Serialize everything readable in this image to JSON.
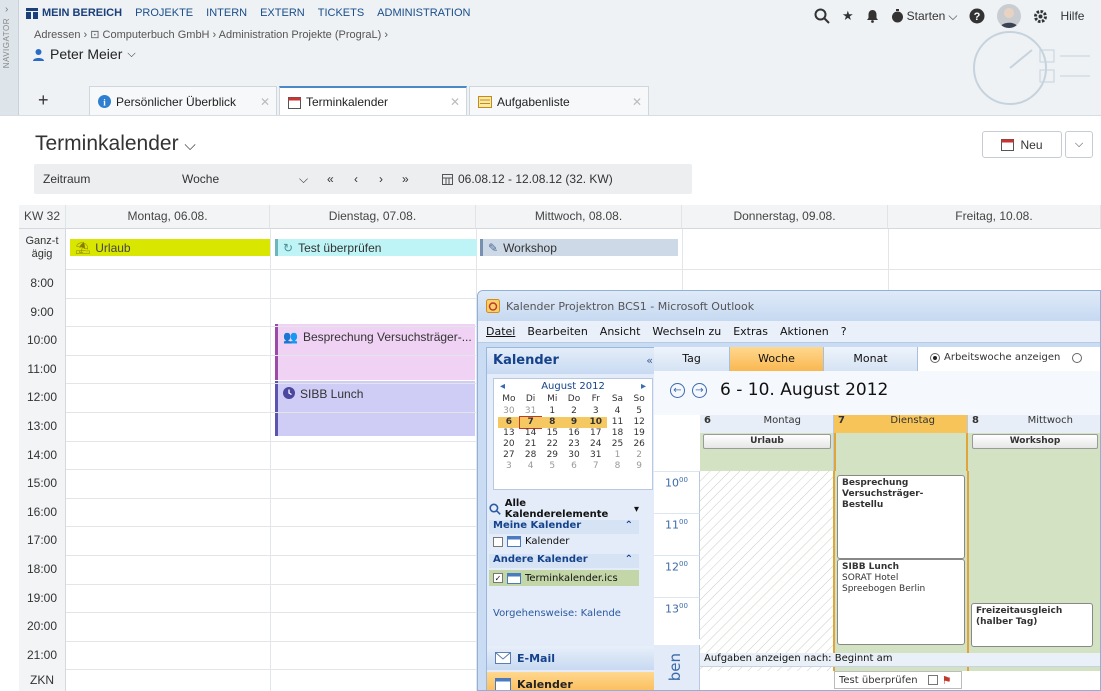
{
  "header": {
    "navigator_label": "NAVIGATOR",
    "nav_items": [
      "MEIN BEREICH",
      "PROJEKTE",
      "INTERN",
      "EXTERN",
      "TICKETS",
      "ADMINISTRATION"
    ],
    "breadcrumb": "Adressen › ⊡ Computerbuch GmbH › Administration Projekte (PrograL) ›",
    "user": "Peter Meier",
    "start_label": "Starten",
    "help_label": "Hilfe"
  },
  "tabs": [
    {
      "label": "Persönlicher Überblick"
    },
    {
      "label": "Terminkalender"
    },
    {
      "label": "Aufgabenliste"
    }
  ],
  "page": {
    "title": "Terminkalender",
    "new_button": "Neu",
    "filter": {
      "period_label": "Zeitraum",
      "period_value": "Woche",
      "prev_fast": "«",
      "prev": "‹",
      "next": "›",
      "next_fast": "»",
      "range": "06.08.12 - 12.08.12 (32. KW)"
    }
  },
  "calendar": {
    "week_label": "KW 32",
    "days": [
      "Montag, 06.08.",
      "Dienstag, 07.08.",
      "Mittwoch, 08.08.",
      "Donnerstag, 09.08.",
      "Freitag, 10.08."
    ],
    "allday_label": "Ganz-tägig",
    "hours": [
      "8:00",
      "9:00",
      "10:00",
      "11:00",
      "12:00",
      "13:00",
      "14:00",
      "15:00",
      "16:00",
      "17:00",
      "18:00",
      "19:00",
      "20:00",
      "21:00"
    ],
    "zkn_label": "ZKN",
    "allday_events": [
      {
        "label": "Urlaub",
        "color": "#d8e600"
      },
      {
        "label": "Test überprüfen",
        "color": "#bff4f6"
      },
      {
        "label": "Workshop",
        "color": "#cdd9e6"
      }
    ],
    "events": [
      {
        "label": "Besprechung Versuchsträger-...",
        "color": "#f0d2f5"
      },
      {
        "label": "SIBB Lunch",
        "color": "#cfcdf5"
      }
    ]
  },
  "outlook": {
    "title": "Kalender Projektron BCS1 - Microsoft Outlook",
    "menu": [
      "Datei",
      "Bearbeiten",
      "Ansicht",
      "Wechseln zu",
      "Extras",
      "Aktionen",
      "?"
    ],
    "nav_title": "Kalender",
    "mini_month": "August 2012",
    "mini_days": [
      "Mo",
      "Di",
      "Mi",
      "Do",
      "Fr",
      "Sa",
      "So"
    ],
    "mini_weeks": [
      [
        "30",
        "31",
        "1",
        "2",
        "3",
        "4",
        "5"
      ],
      [
        "6",
        "7",
        "8",
        "9",
        "10",
        "11",
        "12"
      ],
      [
        "13",
        "14",
        "15",
        "16",
        "17",
        "18",
        "19"
      ],
      [
        "20",
        "21",
        "22",
        "23",
        "24",
        "25",
        "26"
      ],
      [
        "27",
        "28",
        "29",
        "30",
        "31",
        "1",
        "2"
      ],
      [
        "3",
        "4",
        "5",
        "6",
        "7",
        "8",
        "9"
      ]
    ],
    "all_items": "Alle Kalenderelemente",
    "my_calendars": "Meine Kalender",
    "my_cal_item": "Kalender",
    "other_calendars": "Andere Kalender",
    "other_cal_item": "Terminkalender.ics",
    "procedure_link": "Vorgehensweise: Kalende",
    "mail_btn": "E-Mail",
    "cal_btn": "Kalender",
    "view_tabs": [
      "Tag",
      "Woche",
      "Monat"
    ],
    "workweek_option": "Arbeitswoche anzeigen",
    "range_title": "6 - 10. August 2012",
    "day_heads": [
      {
        "num": "6",
        "name": "Montag"
      },
      {
        "num": "7",
        "name": "Dienstag"
      },
      {
        "num": "8",
        "name": "Mittwoch"
      }
    ],
    "allday_chips": [
      "Urlaub",
      "Workshop"
    ],
    "hours": [
      "10",
      "11",
      "12",
      "13"
    ],
    "hour_suffix": "00",
    "ev_besprechung": "Besprechung Versuchsträger-Bestellu",
    "ev_sibb": [
      "SIBB Lunch",
      "SORAT Hotel",
      "Spreebogen Berlin"
    ],
    "ev_freizeit": [
      "Freizeitausgleich",
      "(halber Tag)"
    ],
    "tasks_header": "Aufgaben anzeigen nach: Beginnt am",
    "task_item": "Test überprüfen",
    "side_label": "ben"
  }
}
